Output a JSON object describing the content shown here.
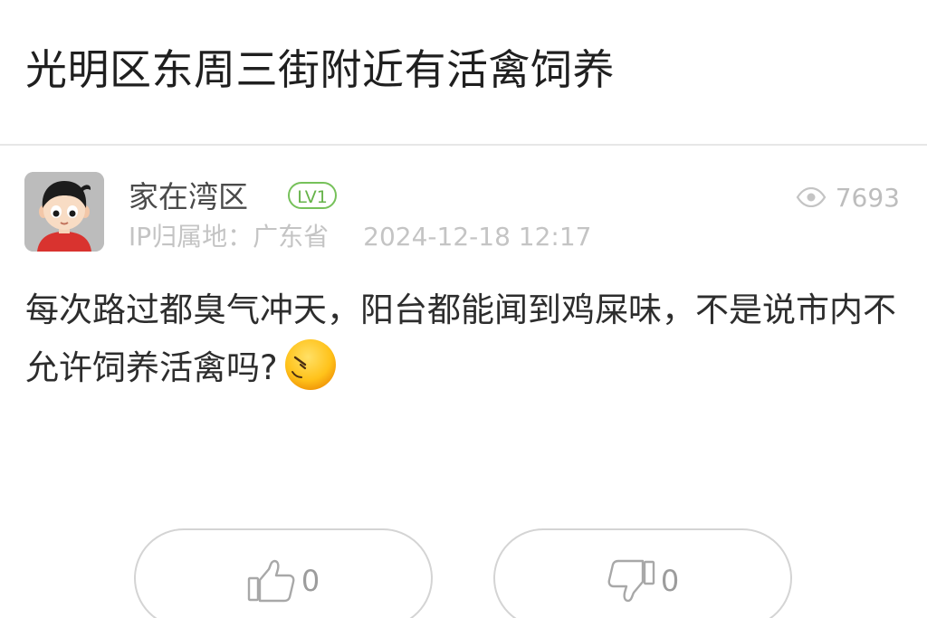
{
  "post": {
    "title": "光明区东周三街附近有活禽饲养",
    "author": {
      "name": "家在湾区",
      "level": "LV1",
      "avatar_icon": "cartoon-boy-avatar"
    },
    "ip_location": "IP归属地：广东省",
    "timestamp": "2024-12-18 12:17",
    "views": "7693",
    "content": "每次路过都臭气冲天，阳台都能闻到鸡屎味，不是说市内不允许饲养活禽吗?",
    "content_emoji": "sleepy-face-emoji"
  },
  "actions": {
    "like_count": "0",
    "dislike_count": "0"
  },
  "colors": {
    "level_badge": "#76c15a",
    "meta_text": "#c4c4c4",
    "divider": "#e7e7e7",
    "button_border": "#d4d4d4",
    "emoji_yellow": "#ffc21a"
  }
}
